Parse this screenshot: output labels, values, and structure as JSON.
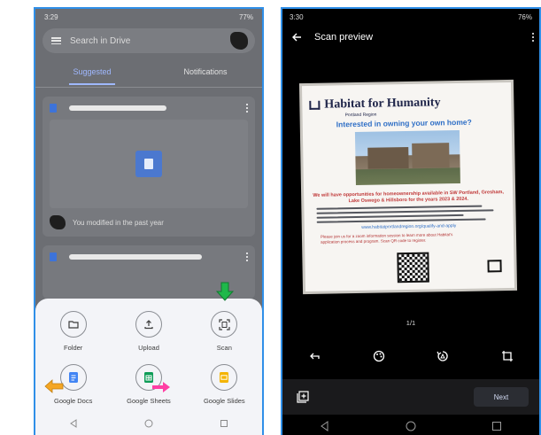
{
  "left": {
    "status_time": "3:29",
    "status_right": "77%",
    "search_placeholder": "Search in Drive",
    "tabs": [
      {
        "label": "Suggested",
        "active": true
      },
      {
        "label": "Notifications",
        "active": false
      }
    ],
    "file_meta": "You modified in the past year",
    "sheet_items": [
      {
        "label": "Folder",
        "icon": "folder-icon"
      },
      {
        "label": "Upload",
        "icon": "upload-icon"
      },
      {
        "label": "Scan",
        "icon": "scan-icon"
      },
      {
        "label": "Google Docs",
        "icon": "google-docs-icon",
        "color": "#4285f4"
      },
      {
        "label": "Google Sheets",
        "icon": "google-sheets-icon",
        "color": "#0f9d58"
      },
      {
        "label": "Google Slides",
        "icon": "google-slides-icon",
        "color": "#f4b400"
      }
    ]
  },
  "right": {
    "status_time": "3:30",
    "status_right": "76%",
    "header_title": "Scan preview",
    "page_indicator": "1/1",
    "next_label": "Next",
    "poster": {
      "title": "Habitat for Humanity",
      "region": "Portland Region",
      "subtitle": "Interested in owning your own home?",
      "headline": "We will have opportunities for homeownership available in SW Portland, Gresham, Lake Oswego & Hillsboro for the years 2023 & 2024.",
      "link": "www.habitatportlandregion.org/qualify-and-apply",
      "footer": "Please join us for a zoom information session to learn more about Habitat's application process and program. Scan QR code to register."
    }
  },
  "colors": {
    "accent_green": "#1fb84a",
    "accent_orange": "#f5a623",
    "accent_pink": "#ff3fa4",
    "border_blue": "#2f8fe8"
  }
}
